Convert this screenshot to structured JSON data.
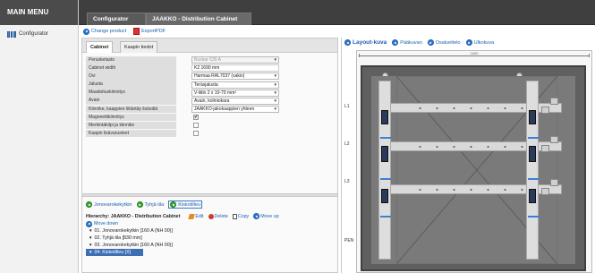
{
  "menu": {
    "title": "MAIN MENU",
    "items": [
      {
        "label": "Configurator",
        "icon": "configurator-icon"
      }
    ]
  },
  "header": {
    "tabs": [
      {
        "label": "Configurator"
      },
      {
        "label": "JAAKKO - Distribution Cabinet"
      }
    ]
  },
  "toolbar": {
    "change_product": "Change product",
    "export_pdf": "ExportPDF"
  },
  "left_panel": {
    "subtabs": [
      "Cabinet",
      "Kaapin tiedot"
    ],
    "fields": [
      {
        "label": "Perusketasto",
        "value": "Busbar 630 A",
        "kind": "select-disabled"
      },
      {
        "label": "Cabinet width",
        "value": "K2 1690 mm",
        "kind": "text"
      },
      {
        "label": "Ovi",
        "value": "Harmaa RAL7037 (vakio)",
        "kind": "select"
      },
      {
        "label": "Jalusta",
        "value": "Teräsjalusta",
        "kind": "select"
      },
      {
        "label": "Maadoituskiinnitys",
        "value": "V-liitin 2 x 10-70 mm²",
        "kind": "select"
      },
      {
        "label": "Avain",
        "value": "Avain, kolmiokara",
        "kind": "select"
      },
      {
        "label": "Kiinnike, kaappien liitäntäy lisävälä",
        "value": "JAAKKO-jakokaappien yhteen",
        "kind": "select"
      },
      {
        "label": "Magneettikiinnitys",
        "checked": true,
        "kind": "check"
      },
      {
        "label": "Merkintäkilpi ja kiinnike",
        "checked": false,
        "kind": "check"
      },
      {
        "label": "Kaapin lisävarusteet",
        "checked": false,
        "kind": "check"
      }
    ],
    "actions": [
      "Jonovarokekytkin",
      "Tyhjä tila",
      "Kiskotilleu"
    ],
    "hierarchy_label": "Hierarchy:",
    "hierarchy_name": "JAAKKO - Distribution Cabinet",
    "hierarchy_actions": [
      "Edit",
      "Delete",
      "Copy",
      "Move up"
    ],
    "move_down": "Move down",
    "tree": [
      {
        "label": "01. Jonovarokekytkin [160 A (NH 00)]",
        "selected": false
      },
      {
        "label": "02. Tyhjä tila [830 mm]",
        "selected": false
      },
      {
        "label": "03. Jonovarokekytkin [160 A (NH 00)]",
        "selected": false
      },
      {
        "label": "04. Kiskotilleu [X]",
        "selected": true
      }
    ]
  },
  "right_panel": {
    "tools": [
      "Layout-kuva",
      "Pääkuvan",
      "Osaluettelo",
      "Ulkokuva"
    ],
    "dimension": "1690",
    "rail_labels": [
      "L1",
      "L2",
      "L3"
    ],
    "pen_label": "PEN"
  },
  "colors": {
    "header_bg": "#3f3f3f",
    "accent_blue": "#2f7bd6",
    "accent_green": "#3ba935",
    "cabinet_bg": "#606060"
  }
}
